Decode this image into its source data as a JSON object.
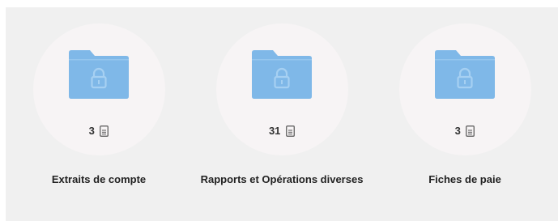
{
  "colors": {
    "panel_background": "#f0f0f0",
    "circle_background": "#f7f4f5",
    "folder_color": "#7fb8e8",
    "text_color": "#222222"
  },
  "folders": [
    {
      "label": "Extraits de compte",
      "count": "3",
      "icon": "locked-folder-icon",
      "count_icon": "document-icon"
    },
    {
      "label": "Rapports et Opérations diverses",
      "count": "31",
      "icon": "locked-folder-icon",
      "count_icon": "document-icon"
    },
    {
      "label": "Fiches de paie",
      "count": "3",
      "icon": "locked-folder-icon",
      "count_icon": "document-icon"
    }
  ]
}
